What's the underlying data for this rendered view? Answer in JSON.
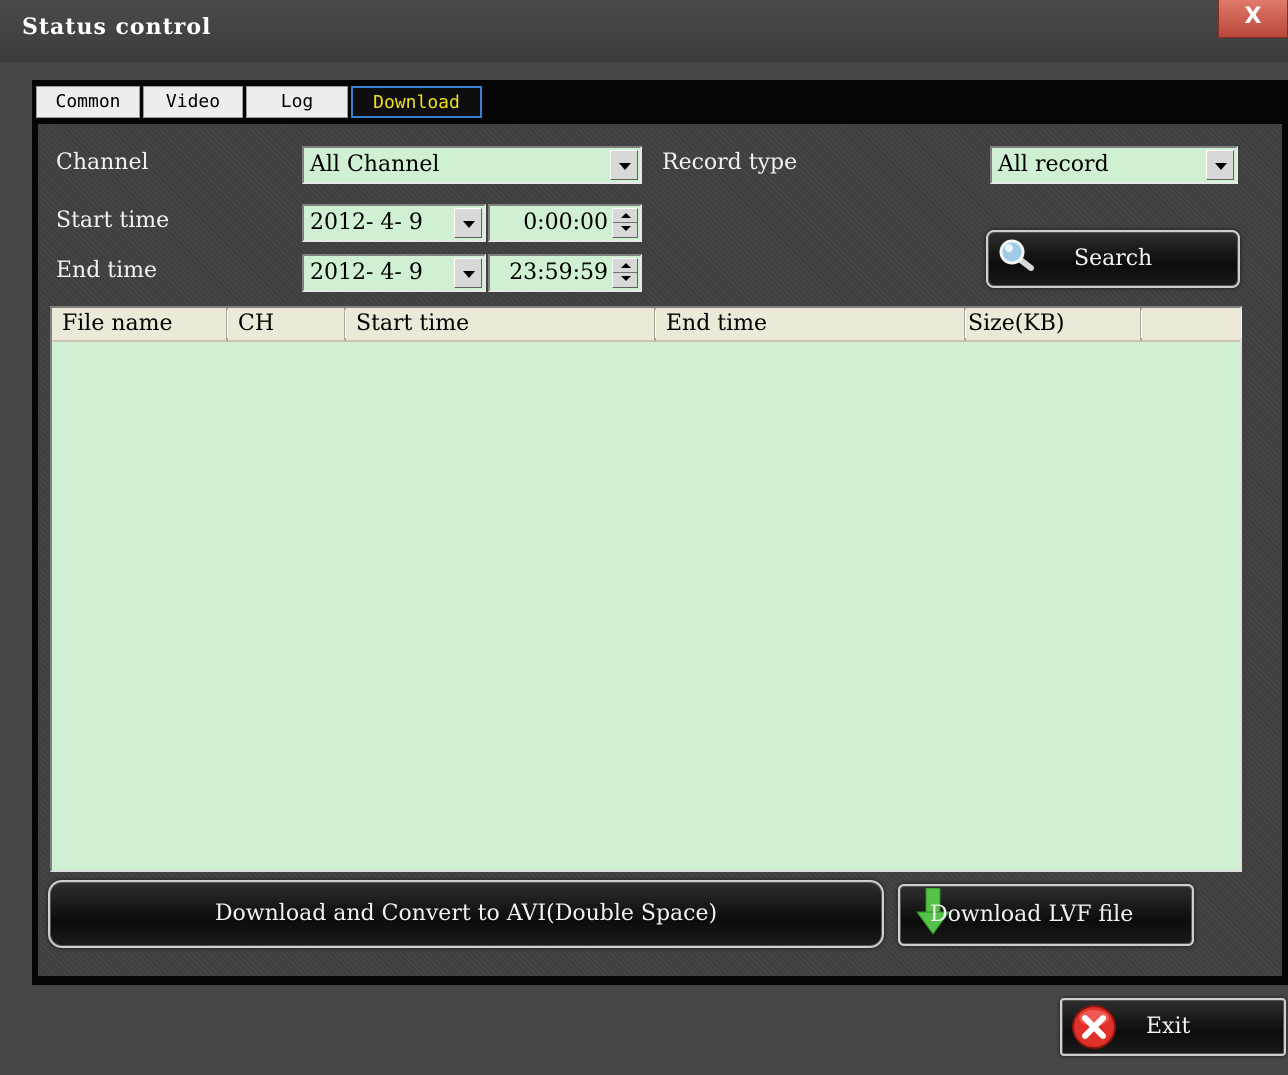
{
  "window": {
    "title": "Status control",
    "close_glyph": "X"
  },
  "tabs": [
    {
      "label": "Common",
      "active": false
    },
    {
      "label": "Video",
      "active": false
    },
    {
      "label": "Log",
      "active": false
    },
    {
      "label": "Download",
      "active": true
    }
  ],
  "filters": {
    "channel_label": "Channel",
    "channel_value": "All Channel",
    "record_type_label": "Record type",
    "record_type_value": "All record",
    "start_label": "Start time",
    "start_date": "2012- 4- 9",
    "start_time": "0:00:00",
    "end_label": "End time",
    "end_date": "2012- 4- 9",
    "end_time": "23:59:59"
  },
  "search_button": {
    "label": "Search",
    "icon": "magnifier-icon"
  },
  "table": {
    "columns": [
      "File name",
      "CH",
      "Start time",
      "End time",
      "Size(KB)",
      ""
    ],
    "rows": []
  },
  "actions": {
    "convert_label": "Download and Convert to AVI(Double Space)",
    "lvf_label": "Download LVF file",
    "lvf_icon": "down-arrow-icon"
  },
  "exit_button": {
    "label": "Exit",
    "icon": "red-x-circle-icon"
  },
  "colors": {
    "background": "#474747",
    "field_green": "#cff0d2",
    "active_tab_text": "#f0e020",
    "active_tab_border": "#3a80d0",
    "header_bg": "#ece9d8"
  }
}
